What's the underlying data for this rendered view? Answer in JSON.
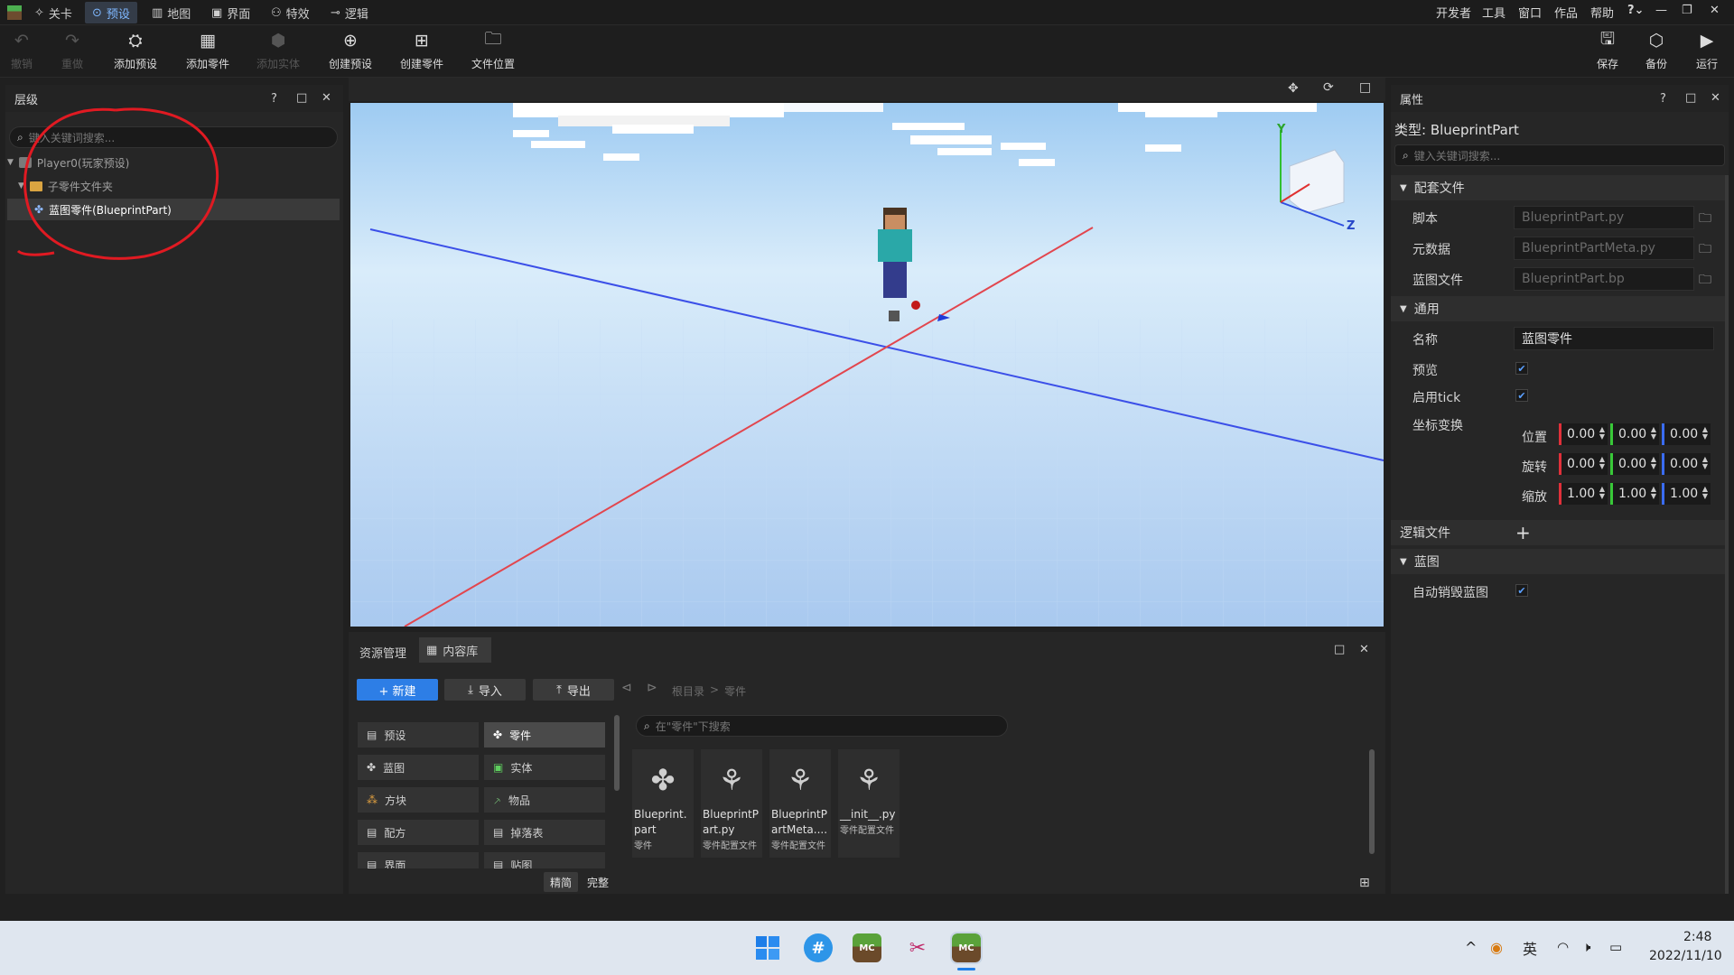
{
  "menubar": {
    "tabs": [
      {
        "label": "关卡",
        "icon": "level-icon"
      },
      {
        "label": "预设",
        "icon": "preset-icon",
        "active": true
      },
      {
        "label": "地图",
        "icon": "map-icon"
      },
      {
        "label": "界面",
        "icon": "ui-icon"
      },
      {
        "label": "特效",
        "icon": "effects-icon"
      },
      {
        "label": "逻辑",
        "icon": "logic-icon"
      }
    ],
    "right": [
      "开发者",
      "工具",
      "窗口",
      "作品",
      "帮助"
    ],
    "help_glyph": "?",
    "help_suffix": "⌄"
  },
  "toolbar": {
    "undo": "撤销",
    "redo": "重做",
    "add_preset": "添加预设",
    "add_part": "添加零件",
    "add_entity": "添加实体",
    "create_preset": "创建预设",
    "create_part": "创建零件",
    "file_location": "文件位置",
    "save": "保存",
    "backup": "备份",
    "run": "运行"
  },
  "hierarchy": {
    "title": "层级",
    "help": "?",
    "search_placeholder": "键入关键词搜索...",
    "items": [
      {
        "label": "Player0(玩家预设)"
      },
      {
        "label": "子零件文件夹"
      },
      {
        "label": "蓝图零件(BlueprintPart)"
      }
    ]
  },
  "properties": {
    "title": "属性",
    "help": "?",
    "type_label": "类型: BlueprintPart",
    "search_placeholder": "键入关键词搜索...",
    "config_section": "配套文件",
    "script_label": "脚本",
    "script_value": "BlueprintPart.py",
    "meta_label": "元数据",
    "meta_value": "BlueprintPartMeta.py",
    "bp_label": "蓝图文件",
    "bp_value": "BlueprintPart.bp",
    "general_section": "通用",
    "name_label": "名称",
    "name_value": "蓝图零件",
    "preview_label": "预览",
    "tick_label": "启用tick",
    "transform_label": "坐标变换",
    "position_label": "位置",
    "rotation_label": "旋转",
    "scale_label": "缩放",
    "pos": [
      "0.00",
      "0.00",
      "0.00"
    ],
    "rot": [
      "0.00",
      "0.00",
      "0.00"
    ],
    "scl": [
      "1.00",
      "1.00",
      "1.00"
    ],
    "logic_label": "逻辑文件",
    "blueprint_section": "蓝图",
    "auto_destroy_label": "自动销毁蓝图",
    "colors": {
      "x": "#e0303a",
      "y": "#38c838",
      "z": "#3a6cf0"
    }
  },
  "viewport": {
    "gizmo_y": "Y",
    "gizmo_z": "Z"
  },
  "assets": {
    "tab_resources": "资源管理",
    "tab_library": "内容库",
    "btn_new": "+ 新建",
    "btn_import": "导入",
    "btn_export": "导出",
    "crumb_root": "根目录",
    "crumb_sep": ">",
    "crumb_current": "零件",
    "search_placeholder": "在\"零件\"下搜索",
    "categories": [
      {
        "label": "预设",
        "icon": "preset-icon"
      },
      {
        "label": "零件",
        "icon": "part-icon",
        "selected": true
      },
      {
        "label": "蓝图",
        "icon": "blueprint-icon"
      },
      {
        "label": "实体",
        "icon": "entity-icon"
      },
      {
        "label": "方块",
        "icon": "block-icon"
      },
      {
        "label": "物品",
        "icon": "item-icon"
      },
      {
        "label": "配方",
        "icon": "recipe-icon"
      },
      {
        "label": "掉落表",
        "icon": "loot-table-icon"
      },
      {
        "label": "界面",
        "icon": "ui-icon"
      },
      {
        "label": "贴图",
        "icon": "texture-icon"
      }
    ],
    "view_simple": "精简",
    "view_full": "完整",
    "files": [
      {
        "name": "Blueprint.part",
        "type": "零件",
        "icon": "part-icon"
      },
      {
        "name": "BlueprintPart.py",
        "type": "零件配置文件",
        "icon": "python-icon"
      },
      {
        "name": "BlueprintPartMeta....",
        "type": "零件配置文件",
        "icon": "python-icon"
      },
      {
        "name": "__init__.py",
        "type": "零件配置文件",
        "icon": "python-icon"
      }
    ]
  },
  "taskbar": {
    "hash_glyph": "#",
    "mc_glyph": "MC",
    "ime": "英",
    "time": "2:48",
    "date": "2022/11/10",
    "chevron": "^"
  }
}
